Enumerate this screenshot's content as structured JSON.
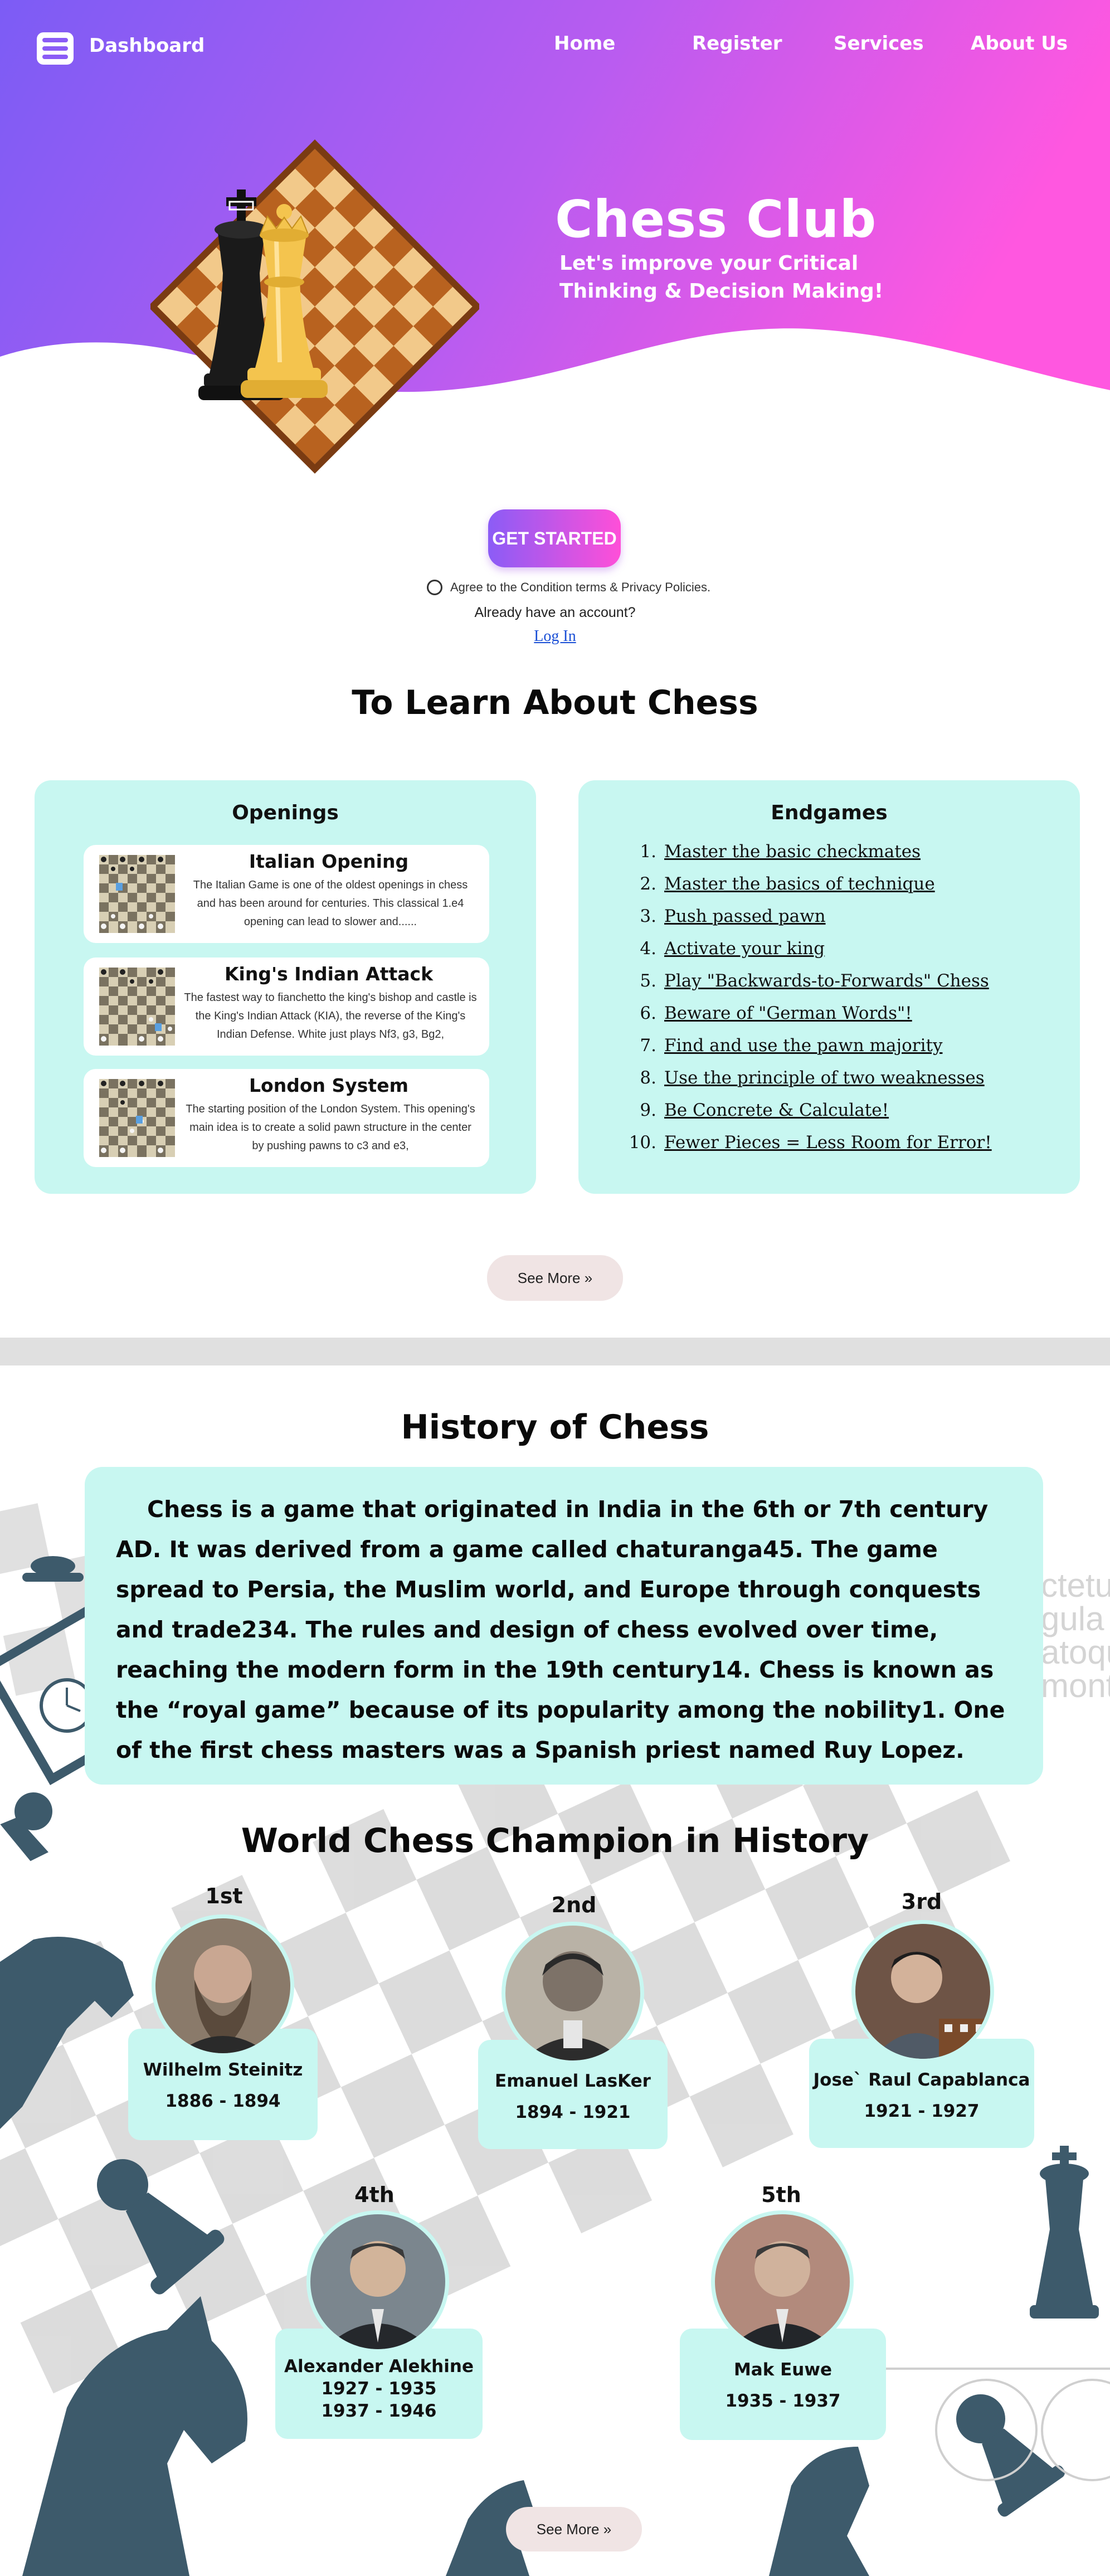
{
  "nav": {
    "brand": "Dashboard",
    "links": [
      "Home",
      "Register",
      "Services",
      "About Us"
    ],
    "burger_icon": "menu-icon"
  },
  "hero": {
    "title": "Chess Club",
    "subtitle": "Let's improve your Critical Thinking & Decision Making!",
    "gradient_start": "#7c5cf5",
    "gradient_end": "#ff57e0"
  },
  "cta": {
    "button": "GET STARTED",
    "agree_label": "Agree to the Condition terms & Privacy Policies.",
    "already": "Already have an account?",
    "login": "Log In"
  },
  "learn": {
    "title": "To Learn About Chess",
    "openings_title": "Openings",
    "openings": [
      {
        "name": "Italian Opening",
        "desc": "The Italian Game is one of the oldest openings in chess and has been around for centuries. This classical 1.e4 opening can lead to slower and......"
      },
      {
        "name": "King's Indian Attack",
        "desc": "The fastest way to fianchetto the king's bishop and castle is the King's Indian Attack (KIA), the reverse of the King's Indian Defense. White just plays Nf3, g3, Bg2,"
      },
      {
        "name": "London System",
        "desc": "The starting position of the London System. This opening's main idea is to create a solid pawn structure in the center by pushing pawns to c3 and e3,"
      }
    ],
    "endgames_title": "Endgames",
    "endgames": [
      "Master the basic checkmates",
      "Master the basics of technique",
      "Push passed pawn",
      "Activate your king",
      "Play \"Backwards-to-Forwards\" Chess",
      "Beware of \"German Words\"!",
      "Find and use the pawn majority",
      "Use the principle of two weaknesses",
      "Be Concrete & Calculate!",
      "Fewer Pieces = Less Room for Error!"
    ],
    "see_more": "See More »"
  },
  "history": {
    "title": "History of Chess",
    "text": "Chess is a game that originated in India in the 6th or 7th century AD. It was derived from a game called chaturanga45. The game spread to Persia, the Muslim world, and Europe through conquests and trade234. The rules and design of chess evolved over time, reaching the modern form in the 19th century14. Chess is known as the “royal game” because of its popularity among the nobility1. One of the first chess masters was a Spanish priest named Ruy Lopez.",
    "ghost_text": "ctetue\ngula e\natoqu\nmont"
  },
  "champions": {
    "title": "World Chess Champion in History",
    "list": [
      {
        "rank": "1st",
        "name": "Wilhelm Steinitz",
        "years": [
          "1886 - 1894"
        ]
      },
      {
        "rank": "2nd",
        "name": "Emanuel LasKer",
        "years": [
          "1894 - 1921"
        ]
      },
      {
        "rank": "3rd",
        "name": "Jose` Raul Capablanca",
        "years": [
          "1921 - 1927"
        ]
      },
      {
        "rank": "4th",
        "name": "Alexander Alekhine",
        "years": [
          "1927 - 1935",
          "1937 - 1946"
        ]
      },
      {
        "rank": "5th",
        "name": "Mak Euwe",
        "years": [
          "1935 - 1937"
        ]
      }
    ],
    "see_more": "See More »"
  },
  "colors": {
    "card_bg": "#c8f7f1",
    "accent_purple": "#8b5cf6",
    "accent_pink": "#ff4fd8",
    "piece_dark": "#3d5a6b"
  }
}
